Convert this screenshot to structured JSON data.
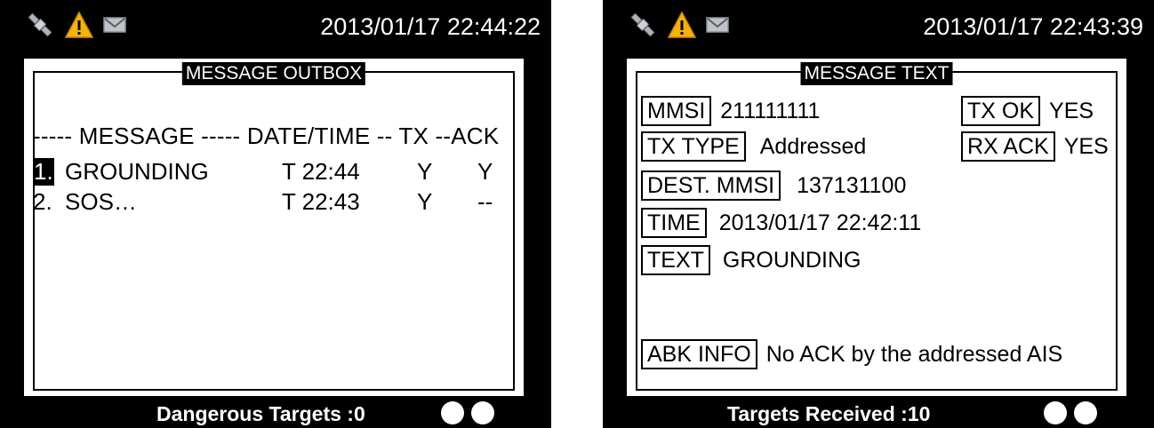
{
  "left_screen": {
    "datetime": "2013/01/17 22:44:22",
    "title": "MESSAGE OUTBOX",
    "header": "----- MESSAGE ----- DATE/TIME -- TX --ACK",
    "rows": [
      {
        "num": "1.",
        "message": "GROUNDING",
        "time": "T 22:44",
        "tx": "Y",
        "ack": "Y"
      },
      {
        "num": "2.",
        "message": "SOS…",
        "time": "T 22:43",
        "tx": "Y",
        "ack": "--"
      }
    ],
    "bottom_text": "Dangerous Targets :0"
  },
  "right_screen": {
    "datetime": "2013/01/17 22:43:39",
    "title": "MESSAGE TEXT",
    "mmsi": {
      "label": "MMSI",
      "value": "211111111"
    },
    "tx_ok": {
      "label": "TX OK",
      "value": "YES"
    },
    "tx_type": {
      "label": "TX TYPE",
      "value": "Addressed"
    },
    "rx_ack": {
      "label": "RX ACK",
      "value": "YES"
    },
    "dest_mmsi": {
      "label": "DEST. MMSI",
      "value": "137131100"
    },
    "time": {
      "label": "TIME",
      "value": "2013/01/17 22:42:11"
    },
    "text": {
      "label": "TEXT",
      "value": "GROUNDING"
    },
    "abk_info": {
      "label": "ABK INFO",
      "value": "No ACK by the addressed AIS"
    },
    "bottom_text": "Targets Received :10"
  },
  "icons": [
    "satellite-icon",
    "warning-icon",
    "mail-icon"
  ],
  "colors": {
    "screen_bg": "#000000",
    "panel_bg": "#ffffff",
    "warning": "#f5b400",
    "satellite": "#b9bec5"
  }
}
